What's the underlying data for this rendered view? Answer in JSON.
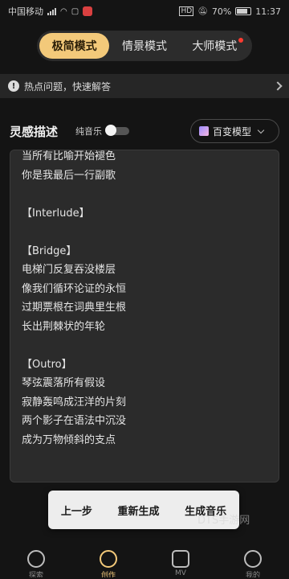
{
  "status_bar": {
    "carrier": "中国移动",
    "battery": "70%",
    "time": "11:37"
  },
  "mode_tabs": [
    {
      "label": "极简模式",
      "active": true
    },
    {
      "label": "情景模式",
      "active": false
    },
    {
      "label": "大师模式",
      "active": false,
      "badge": true
    }
  ],
  "hot_banner": {
    "text": "热点问题，快速解答"
  },
  "inspiration": {
    "title": "灵感描述",
    "pure_music_label": "纯音乐",
    "pure_music_on": false,
    "model_label": "百变模型"
  },
  "lyrics": [
    "当所有比喻开始褪色",
    "你是我最后一行副歌",
    "",
    "【Interlude】",
    "",
    "【Bridge】",
    "电梯门反复吞没楼层",
    "像我们循环论证的永恒",
    "过期票根在词典里生根",
    "长出荆棘状的年轮",
    "",
    "【Outro】",
    "琴弦震落所有假设",
    "寂静轰鸣成汪洋的片刻",
    "两个影子在语法中沉没",
    "成为万物倾斜的支点"
  ],
  "actions": {
    "prev": "上一步",
    "regenerate": "重新生成",
    "generate": "生成音乐"
  },
  "watermark": "DTS手游网",
  "bottom_nav": [
    {
      "label": "探索",
      "icon": "planet-icon",
      "active": false
    },
    {
      "label": "创作",
      "icon": "disc-icon",
      "active": true
    },
    {
      "label": "MV",
      "icon": "play-icon",
      "active": false
    },
    {
      "label": "我的",
      "icon": "face-icon",
      "active": false
    }
  ],
  "colors": {
    "accent": "#f3c97a",
    "background": "#141414",
    "badge": "#ff3b30"
  }
}
